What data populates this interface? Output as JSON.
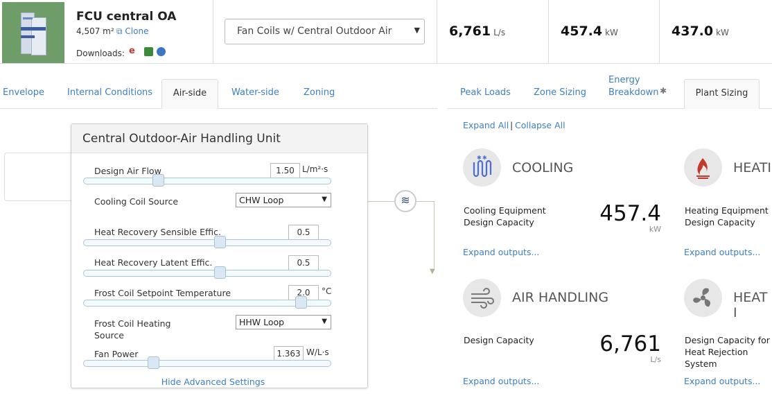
{
  "header": {
    "project_title": "FCU central OA",
    "area": "4,507 m²",
    "clone_label": "Clone",
    "downloads_label": "Downloads:",
    "system_selected": "Fan Coils w/ Central Outdoor Air",
    "metrics": [
      {
        "value": "6,761",
        "unit": "L/s"
      },
      {
        "value": "457.4",
        "unit": "kW"
      },
      {
        "value": "437.0",
        "unit": "kW"
      }
    ]
  },
  "left_tabs": [
    "Envelope",
    "Internal Conditions",
    "Air-side",
    "Water-side",
    "Zoning"
  ],
  "left_active_tab": "Air-side",
  "right_tabs": {
    "peak_loads": "Peak Loads",
    "zone_sizing": "Zone Sizing",
    "energy_line1": "Energy",
    "energy_line2": "Breakdown",
    "plant_sizing": "Plant Sizing"
  },
  "panel": {
    "title": "Central Outdoor-Air Handling Unit",
    "design_air_flow": {
      "label": "Design Air Flow",
      "value": "1.50",
      "unit": "L/m²·s",
      "slider_level": 0.3
    },
    "cooling_coil_source": {
      "label": "Cooling Coil Source",
      "value": "CHW Loop"
    },
    "hr_sensible": {
      "label": "Heat Recovery Sensible Effic.",
      "value": "0.5",
      "slider_level": 0.55
    },
    "hr_latent": {
      "label": "Heat Recovery Latent Effic.",
      "value": "0.5",
      "slider_level": 0.55
    },
    "frost_setpoint": {
      "label": "Frost Coil Setpoint Temperature",
      "value": "2.0",
      "unit": "°C",
      "slider_level": 0.88
    },
    "frost_heating_source": {
      "label_line1": "Frost Coil Heating",
      "label_line2": "Source",
      "value": "HHW Loop"
    },
    "fan_power": {
      "label": "Fan Power",
      "value": "1.363",
      "unit": "W/L·s",
      "slider_level": 0.28
    },
    "hide_advanced": "Hide Advanced Settings"
  },
  "right": {
    "expand_all": "Expand All",
    "separator": "|",
    "collapse_all": "Collapse All",
    "cooling": {
      "title": "COOLING",
      "label_line1": "Cooling Equipment",
      "label_line2": "Design Capacity",
      "value": "457.4",
      "unit": "kW",
      "expand": "Expand outputs..."
    },
    "heating": {
      "title": "HEATI",
      "label_line1": "Heating Equipment",
      "label_line2": "Design Capacity",
      "expand": "Expand outputs..."
    },
    "air_handling": {
      "title": "AIR HANDLING",
      "label": "Design Capacity",
      "value": "6,761",
      "unit": "L/s",
      "expand": "Expand outputs..."
    },
    "heat_rejection": {
      "title": "HEAT I",
      "label_line1": "Design Capacity for",
      "label_line2": "Heat Rejection",
      "label_line3": "System",
      "expand": "Expand outputs..."
    }
  },
  "colors": {
    "link": "#3b7fc4",
    "accent_cooling": "#4a6fd0",
    "accent_heating": "#c0392b"
  }
}
